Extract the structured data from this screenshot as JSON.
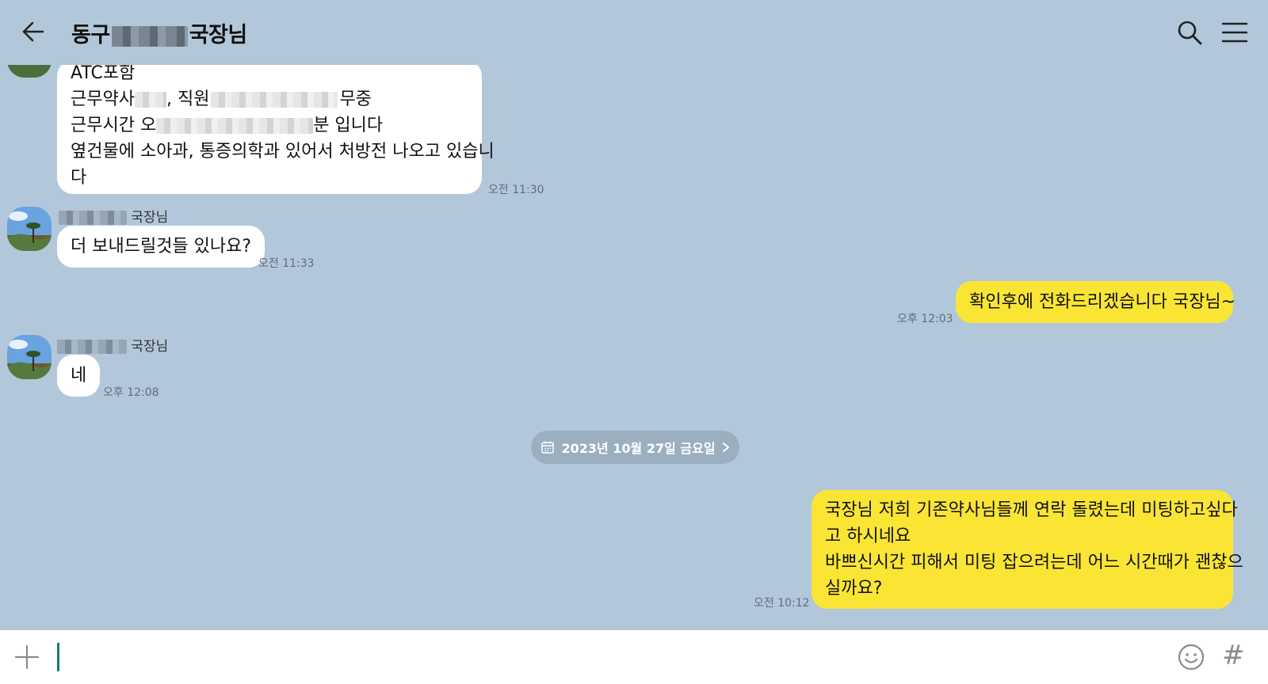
{
  "header": {
    "title_start": "동구",
    "title_end": "국장님"
  },
  "messages": {
    "m1": {
      "line1": "ATC포함",
      "line2a": "근무약사",
      "line2b": ", 직원",
      "line2c": "무중",
      "line3a": "근무시간 오",
      "line3b": "분 입니다",
      "line4": "옆건물에 소아과, 통증의학과 있어서 처방전 나오고 있습니",
      "line5": "다",
      "time": "오전 11:30"
    },
    "m2": {
      "sender_suffix": "국장님",
      "text": "더 보내드릴것들 있나요?",
      "time": "오전 11:33"
    },
    "m3": {
      "text": "확인후에 전화드리겠습니다 국장님~",
      "time": "오후 12:03"
    },
    "m4": {
      "sender_suffix": "국장님",
      "text": "네",
      "time": "오후 12:08"
    },
    "date_divider": "2023년 10월 27일 금요일",
    "m5": {
      "line1": "국장님 저희 기존약사님들께 연락 돌렸는데 미팅하고싶다",
      "line2": "고 하시네요",
      "line3": "바쁘신시간 피해서 미팅 잡으려는데 어느 시간때가 괜찮으",
      "line4": "실까요?",
      "time": "오전 10:12"
    }
  },
  "input": {
    "placeholder": "",
    "hash": "#"
  },
  "icons": [
    "back-arrow-icon",
    "search-icon",
    "menu-icon",
    "calendar-icon",
    "chevron-right-icon",
    "plus-icon",
    "emoji-icon",
    "hash-icon"
  ],
  "colors": {
    "background": "#b2c7da",
    "incoming_bubble": "#ffffff",
    "outgoing_bubble": "#fae535",
    "caret": "#11806e"
  }
}
